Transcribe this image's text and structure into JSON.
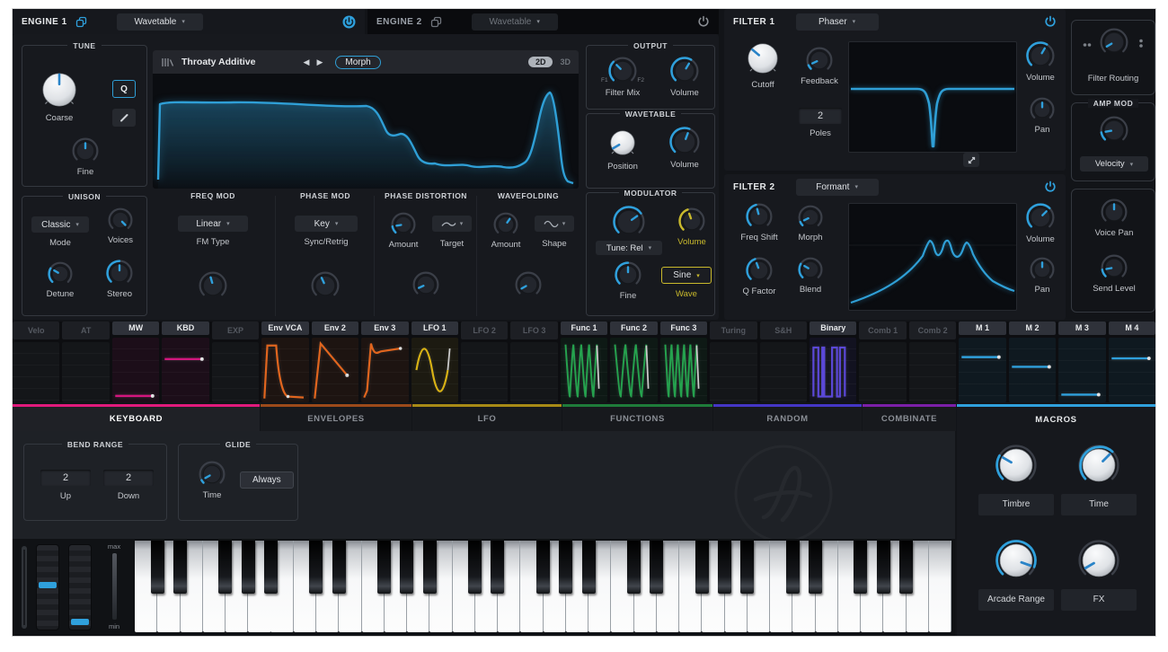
{
  "engine1": {
    "title": "ENGINE 1",
    "type": "Wavetable",
    "tune_title": "TUNE",
    "coarse": "Coarse",
    "fine": "Fine",
    "q": "Q",
    "wt_name": "Throaty Additive",
    "morph": "Morph",
    "d2": "2D",
    "d3": "3D",
    "unison_title": "UNISON",
    "unison_mode": "Classic",
    "mode": "Mode",
    "voices": "Voices",
    "detune": "Detune",
    "stereo": "Stereo",
    "freqmod_title": "FREQ MOD",
    "fm_type_value": "Linear",
    "fm_type": "FM Type",
    "phasemod_title": "PHASE MOD",
    "sync_value": "Key",
    "sync": "Sync/Retrig",
    "pd_title": "PHASE DISTORTION",
    "pd_amount": "Amount",
    "pd_target": "Target",
    "wf_title": "WAVEFOLDING",
    "wf_amount": "Amount",
    "wf_shape": "Shape",
    "output_title": "OUTPUT",
    "filter_mix": "Filter Mix",
    "output_volume": "Volume",
    "f1": "F1",
    "f2": "F2",
    "wavetable_title": "WAVETABLE",
    "position": "Position",
    "wt_volume": "Volume",
    "mod_title": "MODULATOR",
    "mod_tune_value": "Tune: Rel",
    "mod_volume": "Volume",
    "mod_fine": "Fine",
    "mod_wave_value": "Sine",
    "mod_wave": "Wave"
  },
  "engine2": {
    "title": "ENGINE 2",
    "type": "Wavetable"
  },
  "filter1": {
    "title": "FILTER 1",
    "type": "Phaser",
    "cutoff": "Cutoff",
    "feedback": "Feedback",
    "poles_value": "2",
    "poles": "Poles",
    "volume": "Volume",
    "pan": "Pan"
  },
  "filter2": {
    "title": "FILTER 2",
    "type": "Formant",
    "freq_shift": "Freq Shift",
    "morph": "Morph",
    "q_factor": "Q Factor",
    "blend": "Blend",
    "volume": "Volume",
    "pan": "Pan"
  },
  "right": {
    "filter_routing": "Filter Routing",
    "amp_mod_title": "AMP MOD",
    "amp_mod_value": "Velocity",
    "voice_pan": "Voice Pan",
    "send_level": "Send Level"
  },
  "colors": {
    "accent": "#2fa0dc",
    "yellow": "#c9b92c",
    "magenta": "#d3167e",
    "orange": "#e0651e",
    "green": "#25a24e",
    "purple": "#5b48d8"
  },
  "mod_slots": [
    {
      "label": "Velo",
      "active": false,
      "viz": "none"
    },
    {
      "label": "AT",
      "active": false,
      "viz": "none"
    },
    {
      "label": "MW",
      "active": true,
      "viz": "hline",
      "color": "#d3167e",
      "pos": 0.9
    },
    {
      "label": "KBD",
      "active": true,
      "viz": "hline",
      "color": "#d3167e",
      "pos": 0.33
    },
    {
      "label": "EXP",
      "active": false,
      "viz": "none"
    },
    {
      "label": "Env VCA",
      "active": true,
      "viz": "env_vca",
      "color": "#e0651e"
    },
    {
      "label": "Env 2",
      "active": true,
      "viz": "env2",
      "color": "#e0651e"
    },
    {
      "label": "Env 3",
      "active": true,
      "viz": "env3",
      "color": "#e0651e"
    },
    {
      "label": "LFO 1",
      "active": true,
      "viz": "sine",
      "color": "#d8b215"
    },
    {
      "label": "LFO 2",
      "active": false,
      "viz": "none"
    },
    {
      "label": "LFO 3",
      "active": false,
      "viz": "none"
    },
    {
      "label": "Func 1",
      "active": true,
      "viz": "func1",
      "color": "#25a24e"
    },
    {
      "label": "Func 2",
      "active": true,
      "viz": "func2",
      "color": "#25a24e"
    },
    {
      "label": "Func 3",
      "active": true,
      "viz": "func3",
      "color": "#25a24e"
    },
    {
      "label": "Turing",
      "active": false,
      "viz": "none"
    },
    {
      "label": "S&H",
      "active": false,
      "viz": "none"
    },
    {
      "label": "Binary",
      "active": true,
      "viz": "square",
      "color": "#5b48d8"
    },
    {
      "label": "Comb 1",
      "active": false,
      "viz": "none"
    },
    {
      "label": "Comb 2",
      "active": false,
      "viz": "none"
    },
    {
      "label": "M 1",
      "active": true,
      "viz": "hline",
      "color": "#2fa0dc",
      "pos": 0.3
    },
    {
      "label": "M 2",
      "active": true,
      "viz": "hline",
      "color": "#2fa0dc",
      "pos": 0.45
    },
    {
      "label": "M 3",
      "active": true,
      "viz": "hline",
      "color": "#2fa0dc",
      "pos": 0.88
    },
    {
      "label": "M 4",
      "active": true,
      "viz": "hline",
      "color": "#2fa0dc",
      "pos": 0.32
    }
  ],
  "tabs": [
    {
      "label": "KEYBOARD",
      "color": "#e11a7c",
      "active": true
    },
    {
      "label": "ENVELOPES",
      "color": "#9c4a1a",
      "active": false
    },
    {
      "label": "LFO",
      "color": "#a88a16",
      "active": false
    },
    {
      "label": "FUNCTIONS",
      "color": "#1e7c3a",
      "active": false
    },
    {
      "label": "RANDOM",
      "color": "#4436c6",
      "active": false
    },
    {
      "label": "COMBINATE",
      "color": "#7b1fa8",
      "active": false
    }
  ],
  "keyboard": {
    "bend_title": "BEND RANGE",
    "up_value": "2",
    "down_value": "2",
    "up": "Up",
    "down": "Down",
    "glide_title": "GLIDE",
    "time": "Time",
    "always": "Always",
    "max": "max",
    "min": "min"
  },
  "macros": {
    "title": "MACROS",
    "knobs": [
      "Timbre",
      "Time",
      "Arcade Range",
      "FX"
    ]
  }
}
